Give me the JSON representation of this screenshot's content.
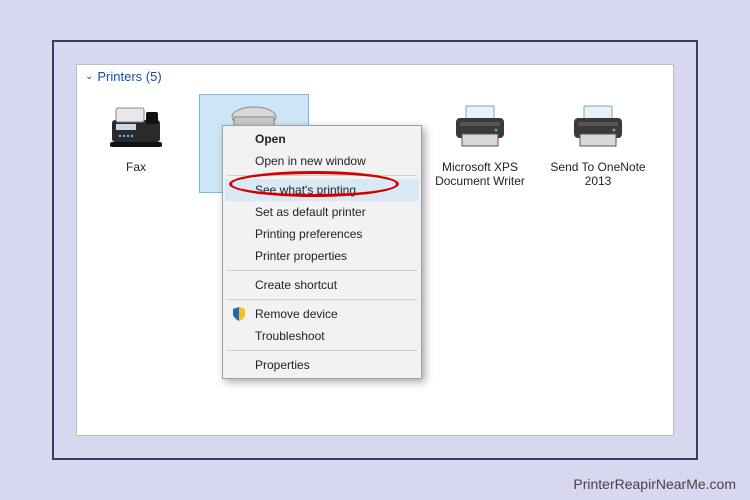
{
  "section": {
    "label": "Printers (5)"
  },
  "devices": [
    {
      "label": "Fax"
    },
    {
      "label": ""
    },
    {
      "label": "Microsoft XPS Document Writer"
    },
    {
      "label": "Send To OneNote 2013"
    }
  ],
  "menu": {
    "open": "Open",
    "open_new": "Open in new window",
    "see_printing": "See what's printing",
    "set_default": "Set as default printer",
    "prefs": "Printing preferences",
    "props": "Printer properties",
    "shortcut": "Create shortcut",
    "remove": "Remove device",
    "troubleshoot": "Troubleshoot",
    "properties": "Properties"
  },
  "watermark": "PrinterReapirNearMe.com"
}
